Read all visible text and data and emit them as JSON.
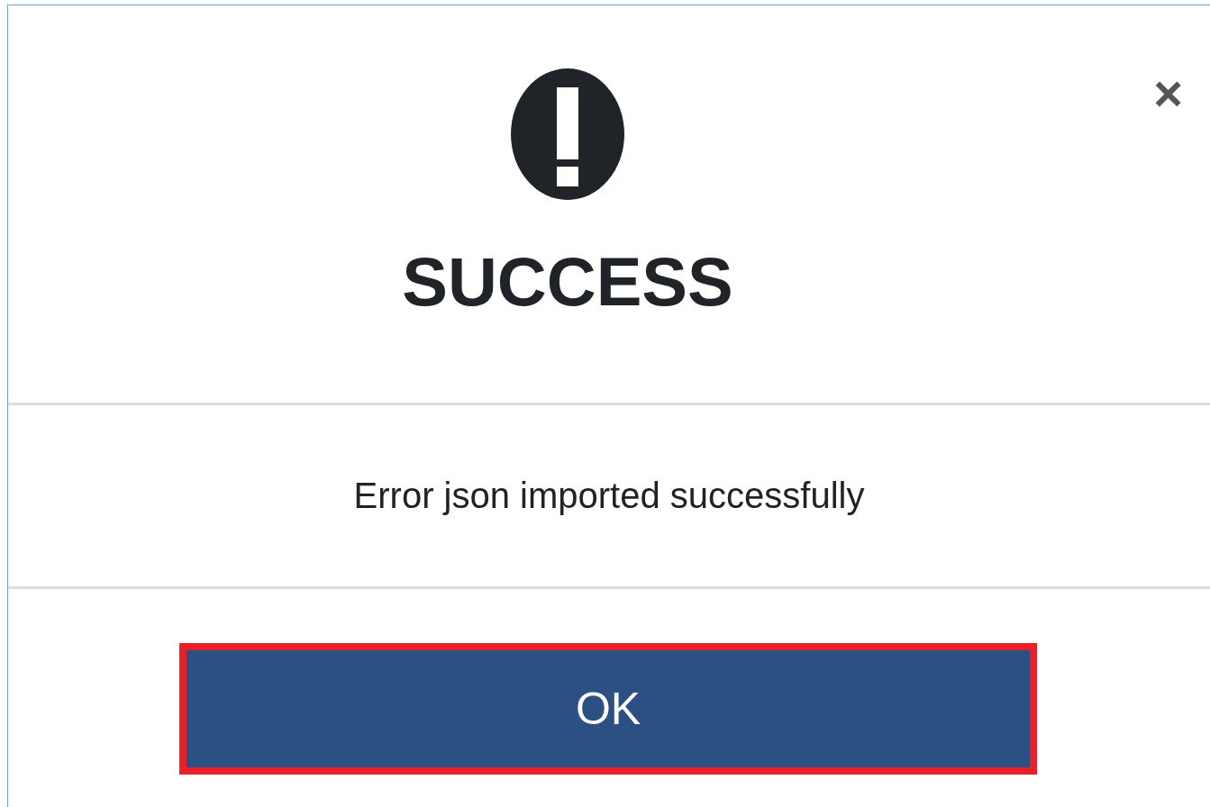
{
  "dialog": {
    "title": "SUCCESS",
    "message": "Error json imported successfully",
    "close": "×",
    "button": {
      "label": "OK",
      "highlighted": true
    }
  }
}
